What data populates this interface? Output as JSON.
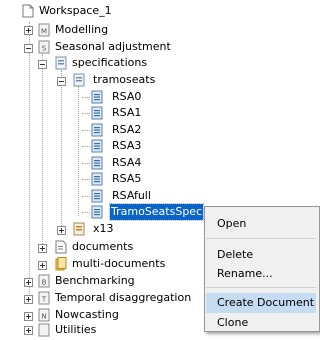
{
  "tree": {
    "workspace": "Workspace_1",
    "modelling": "Modelling",
    "seasonal_adjustment": "Seasonal adjustment",
    "specifications": "specifications",
    "tramoseats": "tramoseats",
    "rsa0": "RSA0",
    "rsa1": "RSA1",
    "rsa2": "RSA2",
    "rsa3": "RSA3",
    "rsa4": "RSA4",
    "rsa5": "RSA5",
    "rsafull": "RSAfull",
    "tramoseats_spec": "TramoSeatsSpec",
    "x13": "x13",
    "documents": "documents",
    "multi_documents": "multi-documents",
    "benchmarking": "Benchmarking",
    "temporal_disaggregation": "Temporal disaggregation",
    "nowcasting": "Nowcasting",
    "utilities": "Utilities"
  },
  "icon_letters": {
    "modelling": "M",
    "seasonal_adjustment": "S",
    "benchmarking": "B",
    "temporal_disaggregation": "T",
    "nowcasting": "N"
  },
  "context_menu": {
    "open": "Open",
    "delete": "Delete",
    "rename": "Rename...",
    "create_document": "Create Document",
    "clone": "Clone"
  },
  "colors": {
    "selection": "#0a64c8",
    "menu_highlight": "#c6dcf2",
    "menu_background": "#f0f0f0"
  }
}
